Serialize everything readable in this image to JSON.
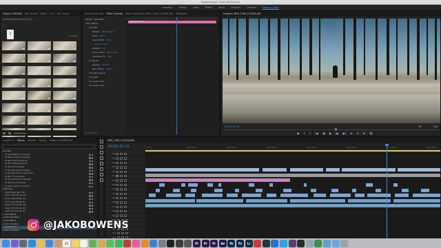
{
  "window_title": "Untitled Project - Adobe Premiere Pro",
  "workspaces": [
    "Assembly",
    "Editing",
    "Color",
    "Effects",
    "Audio",
    "Graphics",
    "Libraries",
    "Editing 2 (Edit)"
  ],
  "active_workspace": 7,
  "project": {
    "tabs": [
      "Project: CHRONIS",
      "Bin: Archive - 16004 - 3 0.3",
      "Bin: Audio"
    ],
    "path": "CHRONIS_ROUGHEDIT.prproj",
    "count": "75 items",
    "thumb_colors": [
      "#6e6a60",
      "#8e8d86",
      "#a99a7d",
      "#7b6e5d",
      "#9b8b73",
      "#555b5e",
      "#6a6052",
      "#a8a597",
      "#7f7665",
      "#5d5a52",
      "#8a7a62",
      "#9c9080",
      "#b0a68e",
      "#6c5d49",
      "#7d7c73",
      "#5f625f",
      "#a39d8a",
      "#8f836c",
      "#5b544b",
      "#aaa18b",
      "#7b7466",
      "#6b6356",
      "#9a8e76",
      "#b6ab92"
    ]
  },
  "effect_controls": {
    "tabs": [
      "Source: (no clips)",
      "Effect Controls",
      "Audio Track Mixer: MED_7326_CLOUDS_REL",
      "Metadata"
    ],
    "master": "Master * 8.MAGEN...",
    "clip": "MED_7328_CLOUDS_REL",
    "rows": [
      {
        "label": "Video Effects",
        "level": 0,
        "value": ""
      },
      {
        "label": "fx  Motion",
        "level": 1,
        "value": ""
      },
      {
        "label": "Position",
        "level": 2,
        "value": "960.0  540.0"
      },
      {
        "label": "Scale",
        "level": 2,
        "value": "100.0"
      },
      {
        "label": "Scale Width",
        "level": 2,
        "value": "100.0"
      },
      {
        "label": "",
        "level": 2,
        "value": "Uniform Scale"
      },
      {
        "label": "Rotation",
        "level": 2,
        "value": "0.0"
      },
      {
        "label": "Anchor Point",
        "level": 2,
        "value": "960.0  540.0"
      },
      {
        "label": "Anti-flicker Fi.",
        "level": 2,
        "value": "0.00"
      },
      {
        "label": "fx  Opacity",
        "level": 1,
        "value": ""
      },
      {
        "label": "Opacity",
        "level": 2,
        "value": "100.0 %"
      },
      {
        "label": "Blend Mode",
        "level": 2,
        "value": "Normal"
      },
      {
        "label": "Time Remapping",
        "level": 1,
        "value": ""
      },
      {
        "label": "fx  Lumetri",
        "level": 1,
        "value": ""
      },
      {
        "label": "fx  Lumetri Color",
        "level": 1,
        "value": ""
      },
      {
        "label": "fx  Lumetri Color",
        "level": 1,
        "value": ""
      }
    ],
    "clip_label": "Adjustment Layer",
    "timecode": "00:01:41:21"
  },
  "program": {
    "tab": "Program: MED_7328_CLOUDS_REL",
    "timecode": "00:01:41:21",
    "fit": "Fit",
    "scale": "Full",
    "transport": [
      "◆",
      "{",
      "}",
      "|◀",
      "◀|",
      "▶",
      "|▶",
      "▶|",
      "⊕",
      "⊟",
      "⊞",
      "📷"
    ]
  },
  "effects_panel": {
    "tabs": [
      "Lumetri Sc",
      "Effects",
      "Markers",
      "History",
      "Project: CHRONIS_RE"
    ],
    "items": [
      {
        "label": "Lumetri",
        "type": "folder"
      },
      {
        "label": "SL Gold Western (Universal)",
        "type": "item"
      },
      {
        "label": "SL Mexican Rush (Universal)",
        "type": "item"
      },
      {
        "label": "SL Neon 1974 (Universal)",
        "type": "item"
      },
      {
        "label": "SL Noir 1965 (Universal)",
        "type": "item"
      },
      {
        "label": "SL Noir LC (Universal)",
        "type": "item"
      },
      {
        "label": "SL Noir Noucelle (Universal)",
        "type": "item"
      },
      {
        "label": "SL Noir Noucelle HC (Universal)",
        "type": "item"
      },
      {
        "label": "SL Noir Tri (Universal)",
        "type": "item"
      },
      {
        "label": "SL Purple Minimal (Universal)",
        "type": "item"
      },
      {
        "label": "SL Red Fury (Universal)",
        "type": "item"
      },
      {
        "label": "SL Sepia Dream (Universal)",
        "type": "item"
      },
      {
        "label": "Technical",
        "type": "folder"
      },
      {
        "label": "Legal Range (Rec.709)",
        "type": "item"
      },
      {
        "label": "Full To Legal Range (10)",
        "type": "item"
      },
      {
        "label": "Full To Legal Range (12)",
        "type": "item"
      },
      {
        "label": "Full To Legal Range (8)",
        "type": "item"
      },
      {
        "label": "Legal To Full Range (10)",
        "type": "item"
      },
      {
        "label": "Legal To Full Range (12)",
        "type": "item"
      },
      {
        "label": "Legal To Full Range (8)",
        "type": "item"
      },
      {
        "label": "Audio Effects",
        "type": "folder"
      },
      {
        "label": "Audio Transitions",
        "type": "folder"
      },
      {
        "label": "Video Effects",
        "type": "folder"
      },
      {
        "label": "Color Correction",
        "type": "folder"
      },
      {
        "label": "Lumetri Color",
        "type": "selected"
      },
      {
        "label": "Video Transitions",
        "type": "folder"
      }
    ]
  },
  "timeline": {
    "tab": "MED_7328_CLOUDS_REL",
    "timecode": "00:01:41:21",
    "ruler_ticks": [
      "00:00",
      "00:00:16:00",
      "00:00:32:00",
      "00:00:48:00",
      "00:01:04:00",
      "00:01:20:00",
      "00:01:36:00",
      "00:01:52:00"
    ],
    "video_tracks": [
      "V6",
      "V5",
      "V4",
      "V3",
      "V2",
      "V1"
    ],
    "audio_tracks": [
      "A1",
      "A2",
      "A3",
      "A4",
      "A5",
      "A6",
      "A7",
      "A8",
      "A9",
      "A10",
      "A11",
      "A12",
      "A13",
      "A14"
    ],
    "master": "Master"
  },
  "overlay": {
    "handle": "@JAKOBOWENS"
  },
  "dock": [
    {
      "name": "Finder",
      "color": "#3a8ee6",
      "label": ""
    },
    {
      "name": "Siri",
      "color": "#7a5ad6",
      "label": ""
    },
    {
      "name": "Launchpad",
      "color": "#5f6b7a",
      "label": ""
    },
    {
      "name": "Safari",
      "color": "#2d8ce0",
      "label": ""
    },
    {
      "name": "Chrome",
      "color": "#e8c04a",
      "label": ""
    },
    {
      "name": "Mail",
      "color": "#3d8be0",
      "label": ""
    },
    {
      "name": "Contacts",
      "color": "#c99c63",
      "label": ""
    },
    {
      "name": "Calendar",
      "color": "#f2f2f2",
      "label": "21"
    },
    {
      "name": "Notes",
      "color": "#f5d44f",
      "label": ""
    },
    {
      "name": "Reminders",
      "color": "#f0f0f0",
      "label": ""
    },
    {
      "name": "Maps",
      "color": "#65b05a",
      "label": ""
    },
    {
      "name": "Photos",
      "color": "#e0a54a",
      "label": ""
    },
    {
      "name": "Messages",
      "color": "#4fc45b",
      "label": ""
    },
    {
      "name": "FaceTime",
      "color": "#3fb857",
      "label": ""
    },
    {
      "name": "Photo Booth",
      "color": "#c23a3a",
      "label": ""
    },
    {
      "name": "iTunes",
      "color": "#e85a9c",
      "label": ""
    },
    {
      "name": "iBooks",
      "color": "#e98a2d",
      "label": ""
    },
    {
      "name": "App Store",
      "color": "#2f85e0",
      "label": ""
    },
    {
      "name": "System Preferences",
      "color": "#7b7f86",
      "label": ""
    },
    {
      "name": "Spotify",
      "color": "#1f1f1f",
      "label": ""
    },
    {
      "name": "Final Cut",
      "color": "#3c3c3c",
      "label": ""
    },
    {
      "name": "Compressor",
      "color": "#575757",
      "label": ""
    },
    {
      "name": "Premiere Pro",
      "color": "#2a1a4a",
      "label": "Pr"
    },
    {
      "name": "Premiere Pro",
      "color": "#2a1a4a",
      "label": "Pr"
    },
    {
      "name": "Premiere Pro",
      "color": "#2a1a4a",
      "label": "Pr"
    },
    {
      "name": "After Effects",
      "color": "#1e1e4a",
      "label": "Ae"
    },
    {
      "name": "Photoshop",
      "color": "#0e2a44",
      "label": "Ps"
    },
    {
      "name": "Photoshop",
      "color": "#0e2a44",
      "label": "Ps"
    },
    {
      "name": "Lightroom",
      "color": "#1a2c3c",
      "label": "Lr"
    },
    {
      "name": "Creative Cloud",
      "color": "#d8323a",
      "label": ""
    },
    {
      "name": "Audition",
      "color": "#1a3a3a",
      "label": ""
    },
    {
      "name": "Dropbox",
      "color": "#2a6fd6",
      "label": ""
    },
    {
      "name": "Skype",
      "color": "#2aa3e0",
      "label": ""
    },
    {
      "name": "Slack",
      "color": "#5a3d6e",
      "label": ""
    },
    {
      "name": "Terminal",
      "color": "#2b2b2b",
      "label": ""
    },
    {
      "name": "Preview",
      "color": "#8da6b8",
      "label": ""
    },
    {
      "name": "Activity Monitor",
      "color": "#3e8e4e",
      "label": ""
    },
    {
      "name": "Downloads",
      "color": "#5f9fd8",
      "label": ""
    },
    {
      "name": "Documents",
      "color": "#6aa8db",
      "label": ""
    },
    {
      "name": "Trash",
      "color": "#9ea3a8",
      "label": ""
    }
  ]
}
